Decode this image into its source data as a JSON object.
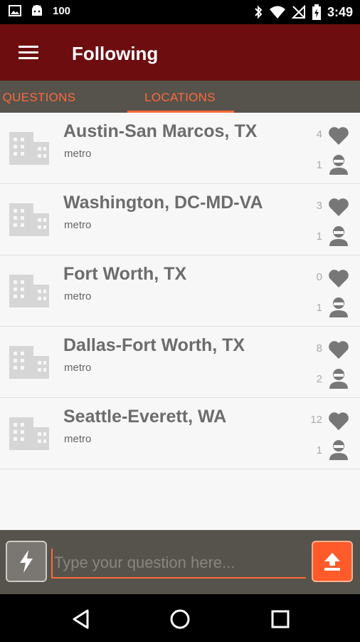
{
  "status_bar": {
    "battery_text": "100",
    "time": "3:49",
    "icons": [
      "image-icon",
      "android-icon",
      "bluetooth-icon",
      "wifi-icon",
      "no-signal-icon",
      "battery-charging-icon"
    ]
  },
  "app_bar": {
    "title": "Following",
    "menu_icon": "hamburger-menu-icon"
  },
  "tabs": [
    {
      "label": "QUESTIONS",
      "selected": false
    },
    {
      "label": "LOCATIONS",
      "selected": true
    }
  ],
  "locations": [
    {
      "name": "Austin-San Marcos, TX",
      "type": "metro",
      "likes": "4",
      "followers": "1"
    },
    {
      "name": "Washington, DC-MD-VA",
      "type": "metro",
      "likes": "3",
      "followers": "1"
    },
    {
      "name": "Fort Worth, TX",
      "type": "metro",
      "likes": "0",
      "followers": "1"
    },
    {
      "name": "Dallas-Fort Worth, TX",
      "type": "metro",
      "likes": "8",
      "followers": "2"
    },
    {
      "name": "Seattle-Everett, WA",
      "type": "metro",
      "likes": "12",
      "followers": "1"
    }
  ],
  "input_bar": {
    "placeholder": "Type your question here...",
    "value": "",
    "left_icon": "lightning-icon",
    "send_icon": "upload-arrow-icon"
  },
  "nav_bar": {
    "icons": [
      "back-icon",
      "home-icon",
      "recents-icon"
    ]
  },
  "colors": {
    "app_bar": "#6d0d0f",
    "accent": "#ff6a3a",
    "tab_bar": "#56524c"
  }
}
